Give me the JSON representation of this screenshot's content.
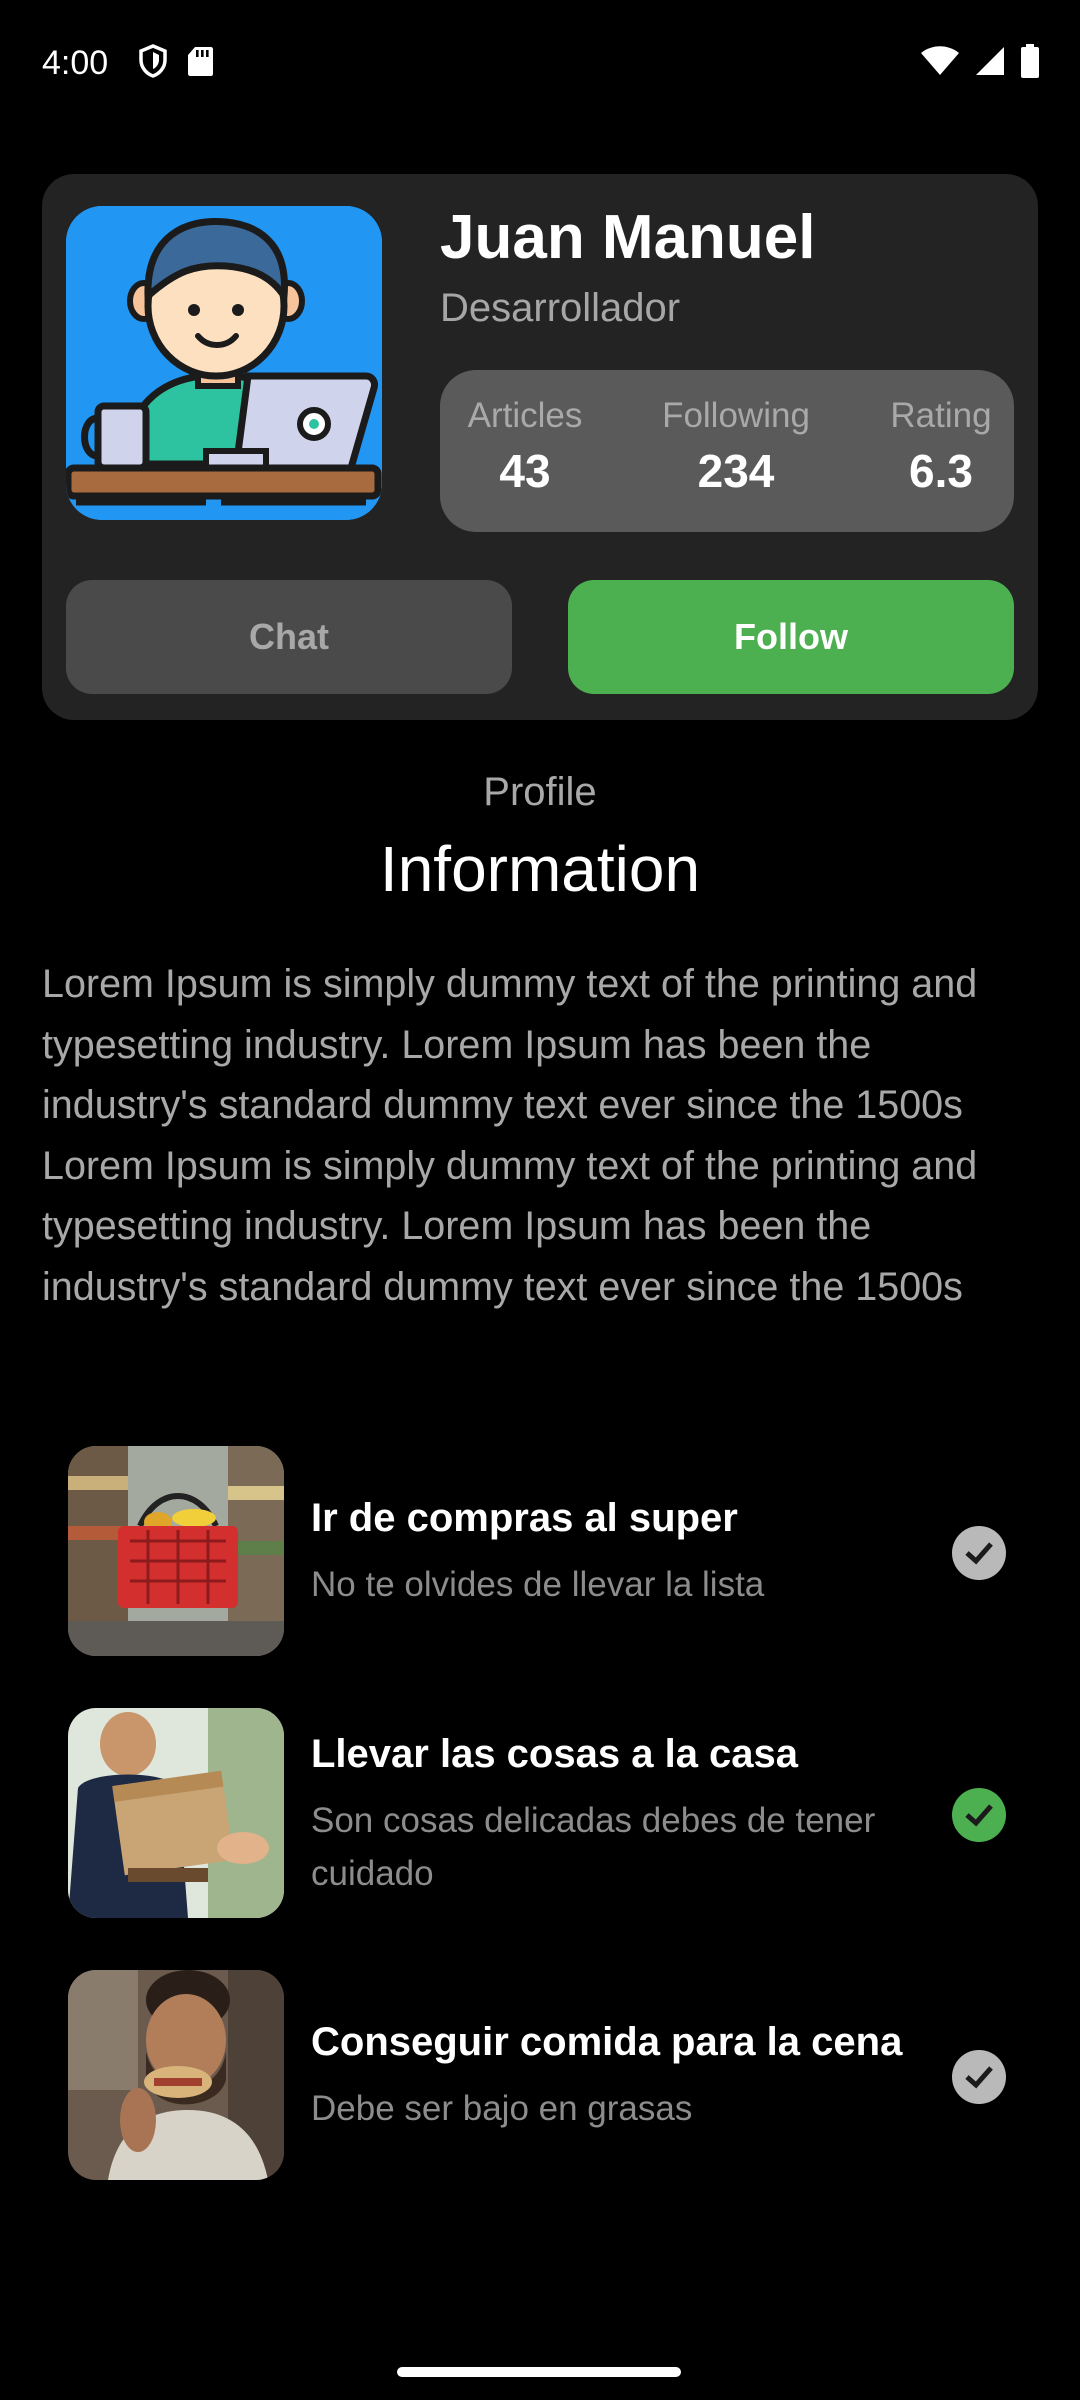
{
  "status_bar": {
    "time": "4:00",
    "left_icons": [
      "shield-icon",
      "sd-card-icon"
    ],
    "right_icons": [
      "wifi-icon",
      "signal-icon",
      "battery-icon"
    ]
  },
  "profile": {
    "name": "Juan Manuel",
    "role": "Desarrollador",
    "stats": [
      {
        "label": "Articles",
        "value": "43"
      },
      {
        "label": "Following",
        "value": "234"
      },
      {
        "label": "Rating",
        "value": "6.3"
      }
    ],
    "chat_label": "Chat",
    "follow_label": "Follow"
  },
  "section": {
    "overline": "Profile",
    "title": "Information",
    "description": "Lorem Ipsum is simply dummy text of the printing and typesetting industry. Lorem Ipsum has been the industry's standard dummy text ever since the 1500s Lorem Ipsum is simply dummy text of the printing and typesetting industry. Lorem Ipsum has been the industry's standard dummy text ever since the 1500s"
  },
  "tasks": [
    {
      "title": "Ir de compras al super",
      "subtitle": "No te olvides de llevar la lista",
      "done": false
    },
    {
      "title": "Llevar las cosas a la casa",
      "subtitle": "Son cosas delicadas debes de tener cuidado",
      "done": true
    },
    {
      "title": "Conseguir comida para la cena",
      "subtitle": "Debe ser bajo en grasas",
      "done": false
    }
  ],
  "colors": {
    "background": "#000000",
    "card": "#232323",
    "follow_green": "#4caf50",
    "check_done": "#4caf50",
    "check_pending": "#b9b9b9"
  }
}
